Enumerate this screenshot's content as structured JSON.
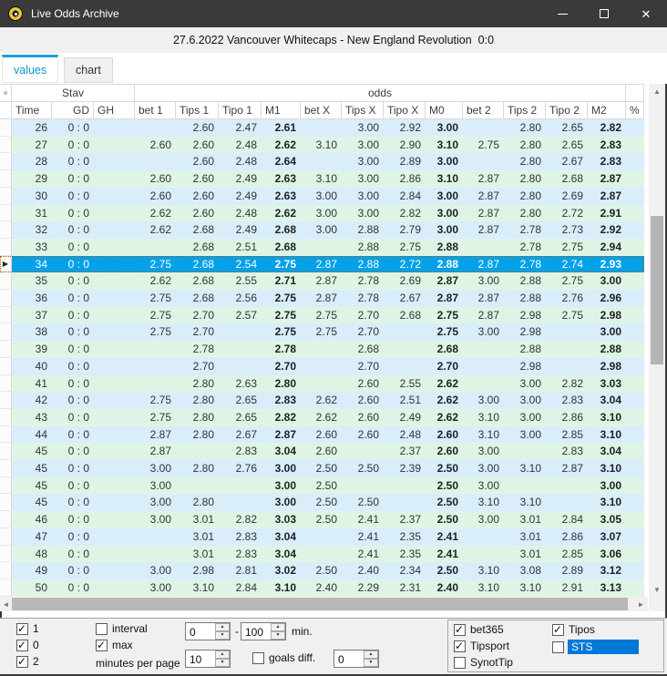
{
  "window": {
    "title": "Live Odds Archive",
    "icon": "coin-icon",
    "close_glyph": "✕"
  },
  "match_header": "27.6.2022 Vancouver Whitecaps - New England Revolution  0:0",
  "tabs": [
    {
      "label": "values",
      "active": true
    },
    {
      "label": "chart",
      "active": false
    }
  ],
  "grid": {
    "corner_glyph": "✳",
    "current_row_glyph": "▶",
    "groups": [
      {
        "label": ""
      },
      {
        "label": "Stav"
      },
      {
        "label": "odds"
      },
      {
        "label": ""
      }
    ],
    "columns": [
      "Time",
      "GD",
      "GH",
      "bet 1",
      "Tips 1",
      "Tipo 1",
      "M1",
      "bet X",
      "Tips X",
      "Tipo X",
      "M0",
      "bet 2",
      "Tips 2",
      "Tipo 2",
      "M2",
      "%"
    ],
    "rows": [
      {
        "cells": [
          "26",
          "0 : 0",
          "",
          "",
          "2.60",
          "2.47",
          "2.61",
          "",
          "3.00",
          "2.92",
          "3.00",
          "",
          "2.80",
          "2.65",
          "2.82",
          ""
        ]
      },
      {
        "cells": [
          "27",
          "0 : 0",
          "",
          "2.60",
          "2.60",
          "2.48",
          "2.62",
          "3.10",
          "3.00",
          "2.90",
          "3.10",
          "2.75",
          "2.80",
          "2.65",
          "2.83",
          ""
        ]
      },
      {
        "cells": [
          "28",
          "0 : 0",
          "",
          "",
          "2.60",
          "2.48",
          "2.64",
          "",
          "3.00",
          "2.89",
          "3.00",
          "",
          "2.80",
          "2.67",
          "2.83",
          ""
        ]
      },
      {
        "cells": [
          "29",
          "0 : 0",
          "",
          "2.60",
          "2.60",
          "2.49",
          "2.63",
          "3.10",
          "3.00",
          "2.86",
          "3.10",
          "2.87",
          "2.80",
          "2.68",
          "2.87",
          ""
        ]
      },
      {
        "cells": [
          "30",
          "0 : 0",
          "",
          "2.60",
          "2.60",
          "2.49",
          "2.63",
          "3.00",
          "3.00",
          "2.84",
          "3.00",
          "2.87",
          "2.80",
          "2.69",
          "2.87",
          ""
        ]
      },
      {
        "cells": [
          "31",
          "0 : 0",
          "",
          "2.62",
          "2.60",
          "2.48",
          "2.62",
          "3.00",
          "3.00",
          "2.82",
          "3.00",
          "2.87",
          "2.80",
          "2.72",
          "2.91",
          ""
        ]
      },
      {
        "cells": [
          "32",
          "0 : 0",
          "",
          "2.62",
          "2.68",
          "2.49",
          "2.68",
          "3.00",
          "2.88",
          "2.79",
          "3.00",
          "2.87",
          "2.78",
          "2.73",
          "2.92",
          ""
        ]
      },
      {
        "cells": [
          "33",
          "0 : 0",
          "",
          "",
          "2.68",
          "2.51",
          "2.68",
          "",
          "2.88",
          "2.75",
          "2.88",
          "",
          "2.78",
          "2.75",
          "2.94",
          ""
        ]
      },
      {
        "cells": [
          "34",
          "0 : 0",
          "",
          "2.75",
          "2.68",
          "2.54",
          "2.75",
          "2.87",
          "2.88",
          "2.72",
          "2.88",
          "2.87",
          "2.78",
          "2.74",
          "2.93",
          ""
        ],
        "selected": true
      },
      {
        "cells": [
          "35",
          "0 : 0",
          "",
          "2.62",
          "2.68",
          "2.55",
          "2.71",
          "2.87",
          "2.78",
          "2.69",
          "2.87",
          "3.00",
          "2.88",
          "2.75",
          "3.00",
          ""
        ]
      },
      {
        "cells": [
          "36",
          "0 : 0",
          "",
          "2.75",
          "2.68",
          "2.56",
          "2.75",
          "2.87",
          "2.78",
          "2.67",
          "2.87",
          "2.87",
          "2.88",
          "2.76",
          "2.96",
          ""
        ]
      },
      {
        "cells": [
          "37",
          "0 : 0",
          "",
          "2.75",
          "2.70",
          "2.57",
          "2.75",
          "2.75",
          "2.70",
          "2.68",
          "2.75",
          "2.87",
          "2.98",
          "2.75",
          "2.98",
          ""
        ]
      },
      {
        "cells": [
          "38",
          "0 : 0",
          "",
          "2.75",
          "2.70",
          "",
          "2.75",
          "2.75",
          "2.70",
          "",
          "2.75",
          "3.00",
          "2.98",
          "",
          "3.00",
          ""
        ]
      },
      {
        "cells": [
          "39",
          "0 : 0",
          "",
          "",
          "2.78",
          "",
          "2.78",
          "",
          "2.68",
          "",
          "2.68",
          "",
          "2.88",
          "",
          "2.88",
          ""
        ]
      },
      {
        "cells": [
          "40",
          "0 : 0",
          "",
          "",
          "2.70",
          "",
          "2.70",
          "",
          "2.70",
          "",
          "2.70",
          "",
          "2.98",
          "",
          "2.98",
          ""
        ]
      },
      {
        "cells": [
          "41",
          "0 : 0",
          "",
          "",
          "2.80",
          "2.63",
          "2.80",
          "",
          "2.60",
          "2.55",
          "2.62",
          "",
          "3.00",
          "2.82",
          "3.03",
          ""
        ]
      },
      {
        "cells": [
          "42",
          "0 : 0",
          "",
          "2.75",
          "2.80",
          "2.65",
          "2.83",
          "2.62",
          "2.60",
          "2.51",
          "2.62",
          "3.00",
          "3.00",
          "2.83",
          "3.04",
          ""
        ]
      },
      {
        "cells": [
          "43",
          "0 : 0",
          "",
          "2.75",
          "2.80",
          "2.65",
          "2.82",
          "2.62",
          "2.60",
          "2.49",
          "2.62",
          "3.10",
          "3.00",
          "2.86",
          "3.10",
          ""
        ]
      },
      {
        "cells": [
          "44",
          "0 : 0",
          "",
          "2.87",
          "2.80",
          "2.67",
          "2.87",
          "2.60",
          "2.60",
          "2.48",
          "2.60",
          "3.10",
          "3.00",
          "2.85",
          "3.10",
          ""
        ]
      },
      {
        "cells": [
          "45",
          "0 : 0",
          "",
          "2.87",
          "",
          "2.83",
          "3.04",
          "2.60",
          "",
          "2.37",
          "2.60",
          "3.00",
          "",
          "2.83",
          "3.04",
          ""
        ]
      },
      {
        "cells": [
          "45",
          "0 : 0",
          "",
          "3.00",
          "2.80",
          "2.76",
          "3.00",
          "2.50",
          "2.50",
          "2.39",
          "2.50",
          "3.00",
          "3.10",
          "2.87",
          "3.10",
          ""
        ]
      },
      {
        "cells": [
          "45",
          "0 : 0",
          "",
          "3.00",
          "",
          "",
          "3.00",
          "2.50",
          "",
          "",
          "2.50",
          "3.00",
          "",
          "",
          "3.00",
          ""
        ]
      },
      {
        "cells": [
          "45",
          "0 : 0",
          "",
          "3.00",
          "2.80",
          "",
          "3.00",
          "2.50",
          "2.50",
          "",
          "2.50",
          "3.10",
          "3.10",
          "",
          "3.10",
          ""
        ]
      },
      {
        "cells": [
          "46",
          "0 : 0",
          "",
          "3.00",
          "3.01",
          "2.82",
          "3.03",
          "2.50",
          "2.41",
          "2.37",
          "2.50",
          "3.00",
          "3.01",
          "2.84",
          "3.05",
          ""
        ]
      },
      {
        "cells": [
          "47",
          "0 : 0",
          "",
          "",
          "3.01",
          "2.83",
          "3.04",
          "",
          "2.41",
          "2.35",
          "2.41",
          "",
          "3.01",
          "2.86",
          "3.07",
          ""
        ]
      },
      {
        "cells": [
          "48",
          "0 : 0",
          "",
          "",
          "3.01",
          "2.83",
          "3.04",
          "",
          "2.41",
          "2.35",
          "2.41",
          "",
          "3.01",
          "2.85",
          "3.06",
          ""
        ]
      },
      {
        "cells": [
          "49",
          "0 : 0",
          "",
          "3.00",
          "2.98",
          "2.81",
          "3.02",
          "2.50",
          "2.40",
          "2.34",
          "2.50",
          "3.10",
          "3.08",
          "2.89",
          "3.12",
          ""
        ]
      },
      {
        "cells": [
          "50",
          "0 : 0",
          "",
          "3.00",
          "3.10",
          "2.84",
          "3.10",
          "2.40",
          "2.29",
          "2.31",
          "2.40",
          "3.10",
          "3.10",
          "2.91",
          "3.13",
          ""
        ]
      }
    ]
  },
  "footer": {
    "outcomes": [
      {
        "label": "1",
        "checked": true
      },
      {
        "label": "0",
        "checked": true
      },
      {
        "label": "2",
        "checked": true
      }
    ],
    "interval": {
      "label": "interval",
      "checked": false
    },
    "max": {
      "label": "max",
      "checked": true
    },
    "minutes_per_page_label": "minutes per page",
    "interval_from": "0",
    "interval_dash": "-",
    "interval_to": "100",
    "min_label": "min.",
    "minutes_per_page_value": "10",
    "goals_diff": {
      "label": "goals diff.",
      "checked": false
    },
    "goals_diff_value": "0",
    "bookmakers": [
      {
        "label": "bet365",
        "checked": true
      },
      {
        "label": "Tipsport",
        "checked": true
      },
      {
        "label": "SynotTip",
        "checked": false
      },
      {
        "label": "Tipos",
        "checked": true
      },
      {
        "label": "STS",
        "checked": false,
        "highlighted": true
      }
    ]
  },
  "colors": {
    "selected_row": "#00a1e9",
    "row_blue": "#d9edfb",
    "row_green": "#def5e5",
    "tab_accent": "#1a9ce1",
    "tab_text": "#0d92d6",
    "highlight": "#0078d7",
    "titlebar": "#3a3a3a"
  }
}
